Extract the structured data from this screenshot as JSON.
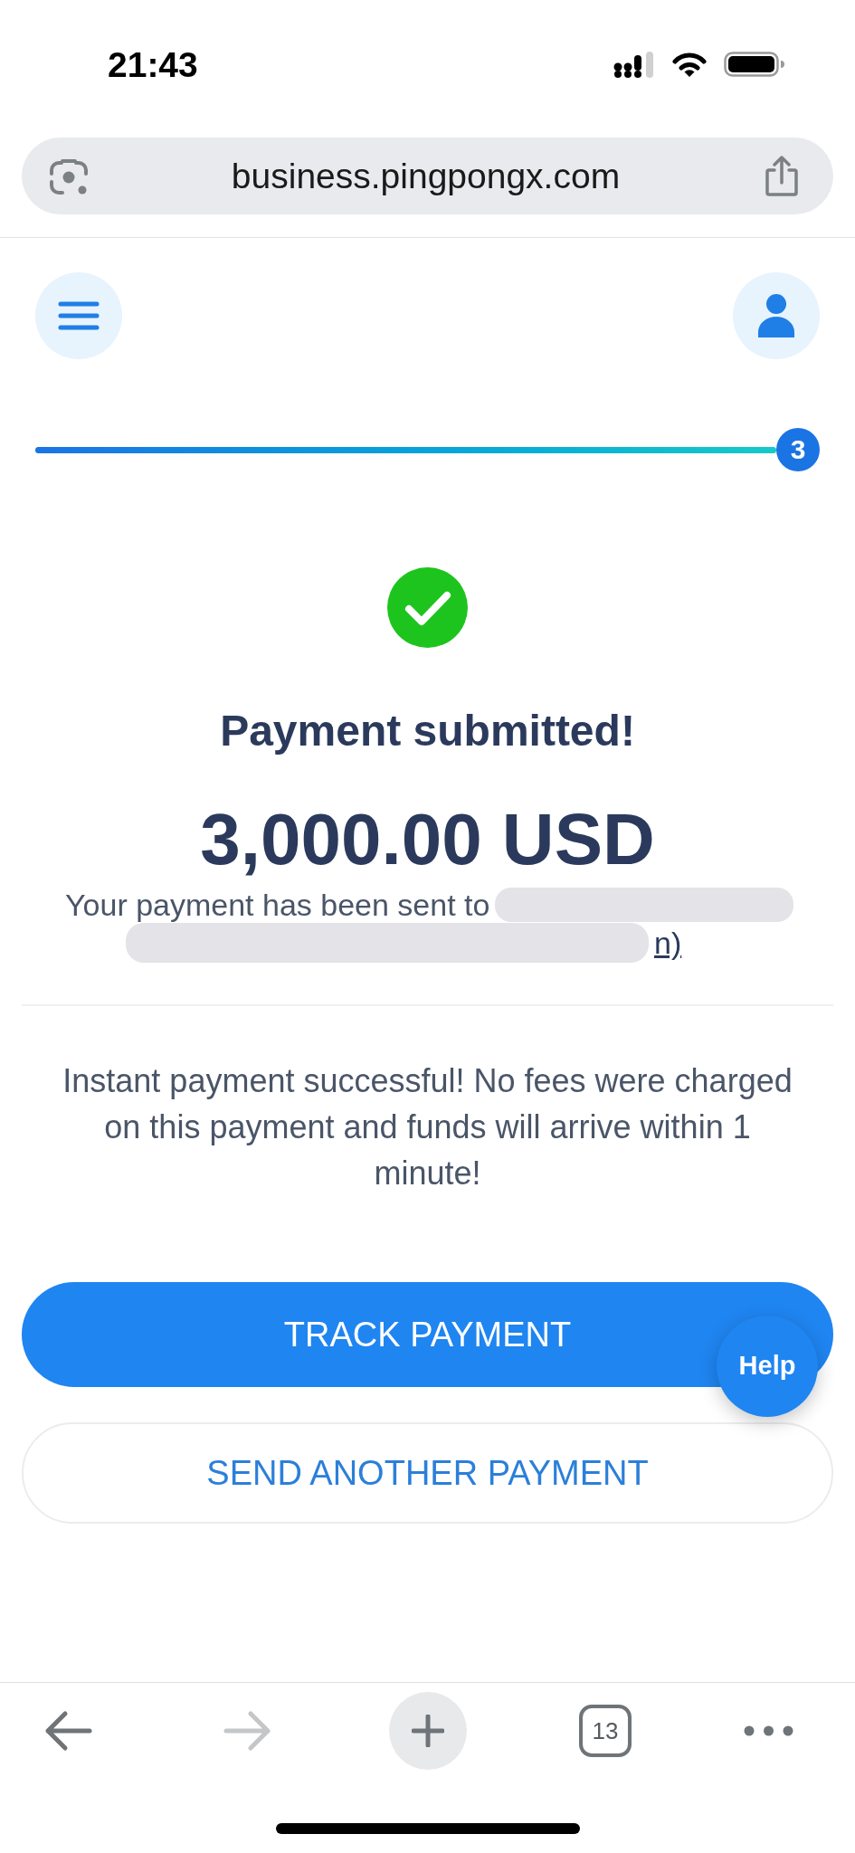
{
  "status_bar": {
    "time": "21:43"
  },
  "address_bar": {
    "url": "business.pingpongx.com"
  },
  "stepper": {
    "level": 1,
    "step": "3"
  },
  "confirmation": {
    "title": "Payment submitted!",
    "amount": "3,000.00 USD",
    "recipient_text": "Your payment has been sent to",
    "redacted": true,
    "recipient_link": "n)",
    "message": "Instant payment successful! No fees were charged on this payment and funds will arrive within 1 minute!"
  },
  "buttons": [
    {
      "label": "TRACK PAYMENT",
      "kind": "primary"
    },
    {
      "label": "SEND ANOTHER PAYMENT",
      "kind": "secondary"
    }
  ],
  "help_button": {
    "label": "Help"
  },
  "toolbar": {
    "back": {
      "disabled": false
    },
    "forward": {
      "disabled": true
    },
    "tab_count": "13"
  }
}
